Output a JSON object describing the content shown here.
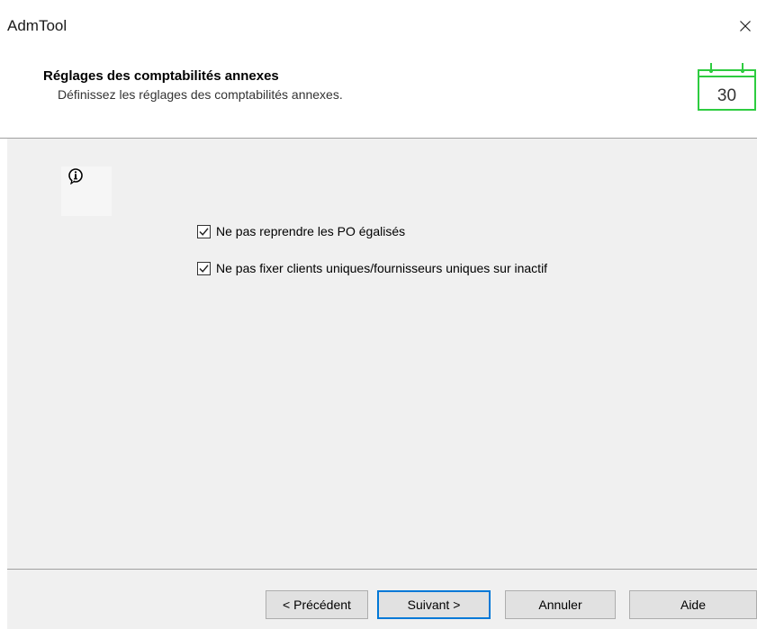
{
  "window": {
    "title": "AdmTool"
  },
  "header": {
    "title": "Réglages des comptabilités annexes",
    "subtitle": "Définissez les réglages des comptabilités annexes.",
    "calendar_day": "30",
    "accent_color": "#2ecc40"
  },
  "options": [
    {
      "label": "Ne pas reprendre les PO égalisés",
      "checked": true
    },
    {
      "label": "Ne pas fixer clients uniques/fournisseurs uniques sur inactif",
      "checked": true
    }
  ],
  "footer": {
    "prev_label": "< Précédent",
    "next_label": "Suivant >",
    "cancel_label": "Annuler",
    "help_label": "Aide"
  },
  "icons": {
    "close": "close-icon",
    "info": "info-icon",
    "calendar": "calendar-icon",
    "check": "checkmark-icon"
  },
  "colors": {
    "focus_border": "#0078d7",
    "panel_background": "#f0f0f0"
  }
}
